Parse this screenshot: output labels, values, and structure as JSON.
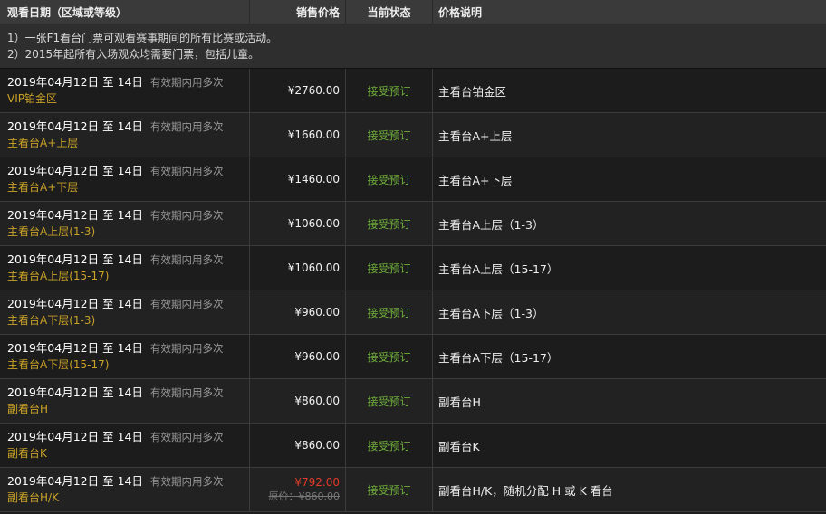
{
  "header": {
    "col_date": "观看日期（区域或等级）",
    "col_price": "销售价格",
    "col_status": "当前状态",
    "col_desc": "价格说明"
  },
  "notes": [
    "1）一张F1看台门票可观看赛事期间的所有比赛或活动。",
    "2）2015年起所有入场观众均需要门票，包括儿童。"
  ],
  "rows": [
    {
      "date": "2019年04月12日 至 14日",
      "validity": "有效期内用多次",
      "zone": "VIP铂金区",
      "price": "¥2760.00",
      "status": "接受预订",
      "desc": "主看台铂金区"
    },
    {
      "date": "2019年04月12日 至 14日",
      "validity": "有效期内用多次",
      "zone": "主看台A+上层",
      "price": "¥1660.00",
      "status": "接受预订",
      "desc": "主看台A+上层"
    },
    {
      "date": "2019年04月12日 至 14日",
      "validity": "有效期内用多次",
      "zone": "主看台A+下层",
      "price": "¥1460.00",
      "status": "接受预订",
      "desc": "主看台A+下层"
    },
    {
      "date": "2019年04月12日 至 14日",
      "validity": "有效期内用多次",
      "zone": "主看台A上层(1-3)",
      "price": "¥1060.00",
      "status": "接受预订",
      "desc": "主看台A上层（1-3）"
    },
    {
      "date": "2019年04月12日 至 14日",
      "validity": "有效期内用多次",
      "zone": "主看台A上层(15-17)",
      "price": "¥1060.00",
      "status": "接受预订",
      "desc": "主看台A上层（15-17）"
    },
    {
      "date": "2019年04月12日 至 14日",
      "validity": "有效期内用多次",
      "zone": "主看台A下层(1-3)",
      "price": "¥960.00",
      "status": "接受预订",
      "desc": "主看台A下层（1-3）"
    },
    {
      "date": "2019年04月12日 至 14日",
      "validity": "有效期内用多次",
      "zone": "主看台A下层(15-17)",
      "price": "¥960.00",
      "status": "接受预订",
      "desc": "主看台A下层（15-17）"
    },
    {
      "date": "2019年04月12日 至 14日",
      "validity": "有效期内用多次",
      "zone": "副看台H",
      "price": "¥860.00",
      "status": "接受预订",
      "desc": "副看台H"
    },
    {
      "date": "2019年04月12日 至 14日",
      "validity": "有效期内用多次",
      "zone": "副看台K",
      "price": "¥860.00",
      "status": "接受预订",
      "desc": "副看台K"
    },
    {
      "date": "2019年04月12日 至 14日",
      "validity": "有效期内用多次",
      "zone": "副看台H/K",
      "price": "¥792.00",
      "original_price": "原价：¥860.00",
      "status": "接受预订",
      "desc": "副看台H/K，随机分配 H 或 K 看台"
    }
  ],
  "colors": {
    "zone": "#c9a227",
    "status": "#6fae3a",
    "sale_price": "#e23a2a",
    "header_bg": "#3a3a3a"
  }
}
